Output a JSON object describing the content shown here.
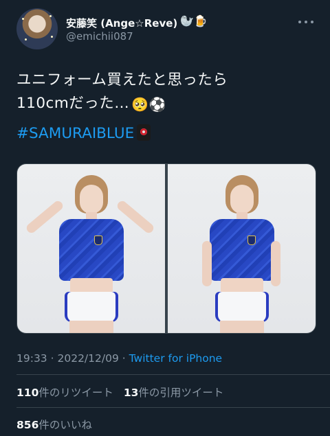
{
  "author": {
    "display_name": "安藤笑 (Ange☆Reve)",
    "badges": "🦭🍺",
    "handle": "@emichii087"
  },
  "tweet": {
    "line1": "ユニフォーム買えたと思ったら",
    "line2": "110cmだった…",
    "line2_emojis": "🥺⚽",
    "hashtag": "#SAMURAIBLUE",
    "flag_emoji": "flag-japan-icon"
  },
  "media": {
    "photos": [
      "photo-left",
      "photo-right"
    ]
  },
  "meta": {
    "time": "19:33",
    "separator": "·",
    "date": "2022/12/09",
    "source": "Twitter for iPhone"
  },
  "stats": {
    "retweets_count": "110",
    "retweets_label": "件のリツイート",
    "quotes_count": "13",
    "quotes_label": "件の引用ツイート",
    "likes_count": "856",
    "likes_label": "件のいいね"
  },
  "colors": {
    "background": "#15202b",
    "accent": "#1d9bf0",
    "text_primary": "#f7f9f9",
    "text_secondary": "#8b98a5",
    "divider": "#38444d"
  }
}
